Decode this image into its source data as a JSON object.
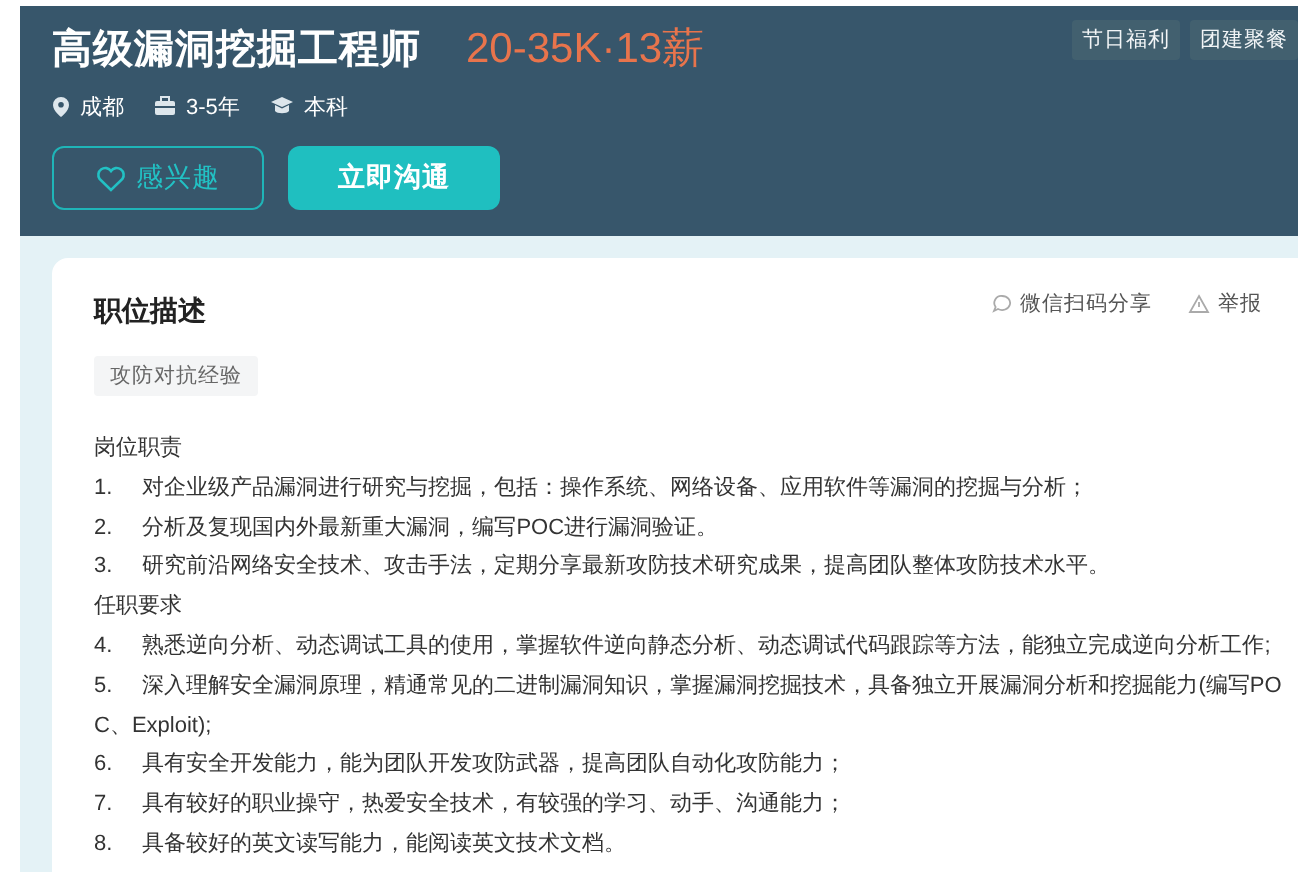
{
  "job": {
    "title": "高级漏洞挖掘工程师",
    "salary": "20-35K·13薪",
    "benefits": [
      "节日福利",
      "团建聚餐"
    ],
    "info": [
      {
        "kind": "location",
        "text": "成都"
      },
      {
        "kind": "experience",
        "text": "3-5年"
      },
      {
        "kind": "education",
        "text": "本科"
      }
    ],
    "buttons": [
      {
        "kind": "outline",
        "label": "感兴趣"
      },
      {
        "kind": "primary",
        "label": "立即沟通"
      }
    ]
  },
  "description": {
    "heading": "职位描述",
    "share": "微信扫码分享",
    "report": "举报",
    "tags": [
      "攻防对抗经验"
    ],
    "sections": [
      {
        "title": "岗位职责",
        "items": [
          {
            "number": "1.",
            "text": "对企业级产品漏洞进行研究与挖掘，包括：操作系统、网络设备、应用软件等漏洞的挖掘与分析；"
          },
          {
            "number": "2.",
            "text": "分析及复现国内外最新重大漏洞，编写POC进行漏洞验证。"
          },
          {
            "number": "3.",
            "text": "研究前沿网络安全技术、攻击手法，定期分享最新攻防技术研究成果，提高团队整体攻防技术水平。"
          }
        ]
      },
      {
        "title": "任职要求",
        "items": [
          {
            "number": "4.",
            "text": "熟悉逆向分析、动态调试工具的使用，掌握软件逆向静态分析、动态调试代码跟踪等方法，能独立完成逆向分析工作;"
          },
          {
            "number": "5.",
            "text": "深入理解安全漏洞原理，精通常见的二进制漏洞知识，掌握漏洞挖掘技术，具备独立开展漏洞分析和挖掘能力(编写POC、Exploit);"
          },
          {
            "number": "6.",
            "text": "具有安全开发能力，能为团队开发攻防武器，提高团队自动化攻防能力；"
          },
          {
            "number": "7.",
            "text": "具有较好的职业操守，热爱安全技术，有较强的学习、动手、沟通能力；"
          },
          {
            "number": "8.",
            "text": "具备较好的英文读写能力，能阅读英文技术文档。"
          }
        ]
      }
    ]
  }
}
